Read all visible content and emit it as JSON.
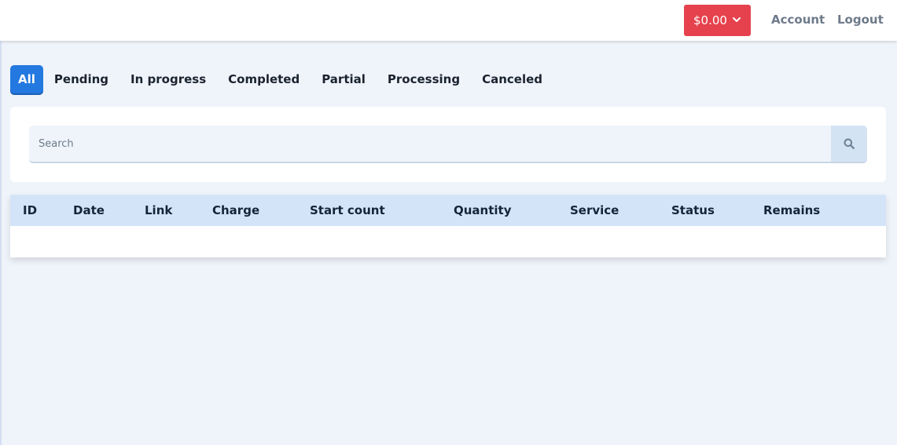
{
  "header": {
    "balance": "$0.00",
    "account_label": "Account",
    "logout_label": "Logout"
  },
  "tabs": [
    {
      "label": "All",
      "active": true
    },
    {
      "label": "Pending"
    },
    {
      "label": "In progress"
    },
    {
      "label": "Completed"
    },
    {
      "label": "Partial"
    },
    {
      "label": "Processing"
    },
    {
      "label": "Canceled"
    }
  ],
  "search": {
    "placeholder": "Search",
    "value": ""
  },
  "table": {
    "columns": [
      "ID",
      "Date",
      "Link",
      "Charge",
      "Start count",
      "Quantity",
      "Service",
      "Status",
      "Remains"
    ],
    "rows": []
  },
  "colors": {
    "accent": "#2479e0",
    "balance_bg": "#e5424d",
    "page_bg": "#eff4fa",
    "table_header_bg": "#d4e4f8"
  },
  "icons": {
    "balance_dropdown": "chevron-down-icon",
    "search_button": "search-icon"
  }
}
